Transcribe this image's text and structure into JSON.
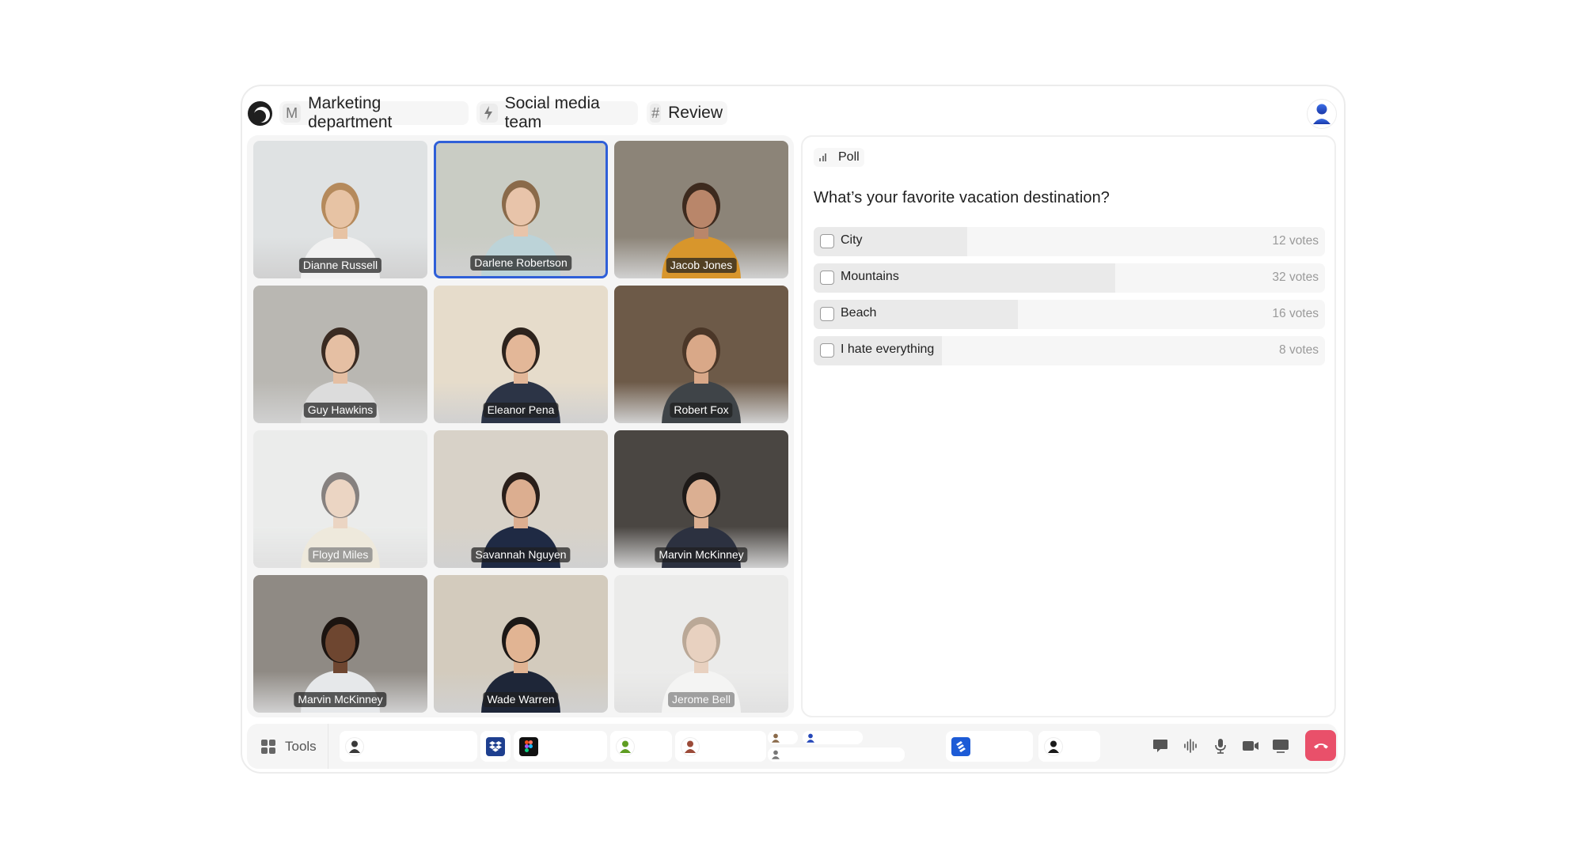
{
  "header": {
    "logo": "app-logo",
    "breadcrumb": [
      {
        "icon_text": "M",
        "icon": "workspace-letter-icon",
        "label": "Marketing department"
      },
      {
        "icon_text": "⚡",
        "icon": "lightning-icon",
        "label": "Social media team"
      },
      {
        "icon_text": "#",
        "icon": "hash-icon",
        "label": "Review"
      }
    ],
    "user_avatar": "user-avatar-icon"
  },
  "participants": [
    {
      "name": "Dianne Russell",
      "active": false,
      "faded": false,
      "bg": "#dfe2e3",
      "skin": "#e7c3a4",
      "hair": "#b58a5c",
      "shirt": "#f1f1f1"
    },
    {
      "name": "Darlene Robertson",
      "active": true,
      "faded": false,
      "bg": "#c9ccc4",
      "skin": "#e8c4aa",
      "hair": "#8a6a4a",
      "shirt": "#bcd3d8"
    },
    {
      "name": "Jacob Jones",
      "active": false,
      "faded": false,
      "bg": "#8c8478",
      "skin": "#b9866a",
      "hair": "#3d2a1e",
      "shirt": "#d8962c"
    },
    {
      "name": "Guy Hawkins",
      "active": false,
      "faded": false,
      "bg": "#b9b7b2",
      "skin": "#e5bfa3",
      "hair": "#3a2b22",
      "shirt": "#dcdcdc"
    },
    {
      "name": "Eleanor Pena",
      "active": false,
      "faded": false,
      "bg": "#e6dccb",
      "skin": "#e3b798",
      "hair": "#2d231d",
      "shirt": "#2c3446"
    },
    {
      "name": "Robert Fox",
      "active": false,
      "faded": false,
      "bg": "#6d5a48",
      "skin": "#d9a888",
      "hair": "#4b3728",
      "shirt": "#3f4448"
    },
    {
      "name": "Floyd Miles",
      "active": false,
      "faded": true,
      "bg": "#e3e6e4",
      "skin": "#e4bb9c",
      "hair": "#2c2420",
      "shirt": "#e9e0c8"
    },
    {
      "name": "Savannah Nguyen",
      "active": false,
      "faded": false,
      "bg": "#d8d2c8",
      "skin": "#dcae90",
      "hair": "#2a1f1a",
      "shirt": "#1f2a44"
    },
    {
      "name": "Marvin McKinney",
      "active": false,
      "faded": false,
      "bg": "#4a4642",
      "skin": "#dbaf92",
      "hair": "#1e1a18",
      "shirt": "#2c3140"
    },
    {
      "name": "Marvin McKinney",
      "active": false,
      "faded": false,
      "bg": "#8f8a84",
      "skin": "#6e4630",
      "hair": "#1c1410",
      "shirt": "#e6e8ea"
    },
    {
      "name": "Wade Warren",
      "active": false,
      "faded": false,
      "bg": "#d3cbbd",
      "skin": "#e1b493",
      "hair": "#1c1816",
      "shirt": "#1e2638"
    },
    {
      "name": "Jerome Bell",
      "active": false,
      "faded": true,
      "bg": "#e4e4e2",
      "skin": "#dfb496",
      "hair": "#8b6b4b",
      "shirt": "#f4f4f2"
    }
  ],
  "poll": {
    "chip_label": "Poll",
    "chip_icon": "poll-bars-icon",
    "question": "What’s your favorite vacation destination?",
    "options": [
      {
        "label": "City",
        "votes_text": "12 votes",
        "votes": 12,
        "fill_fraction": 0.3,
        "checked": false
      },
      {
        "label": "Mountains",
        "votes_text": "32 votes",
        "votes": 32,
        "fill_fraction": 0.59,
        "checked": false
      },
      {
        "label": "Beach",
        "votes_text": "16 votes",
        "votes": 16,
        "fill_fraction": 0.4,
        "checked": false
      },
      {
        "label": "I hate everything",
        "votes_text": "8 votes",
        "votes": 8,
        "fill_fraction": 0.25,
        "checked": false
      }
    ]
  },
  "toolbar": {
    "tools_label": "Tools",
    "tools_icon": "grid-icon",
    "slots": [
      {
        "type": "avatar",
        "icon": "avatar-dark-icon",
        "color": "#3a3a3a"
      },
      {
        "type": "app",
        "icon": "dropbox-icon",
        "color": "#1e3f8f"
      },
      {
        "type": "app",
        "icon": "figma-icon",
        "color": "#111111"
      },
      {
        "type": "avatar",
        "icon": "avatar-green-icon",
        "color": "#5f9d22"
      },
      {
        "type": "avatar",
        "icon": "avatar-brown-icon",
        "color": "#9b4a38"
      },
      {
        "type": "avatar",
        "icon": "avatar-tan-icon",
        "color": "#8a6a4a"
      },
      {
        "type": "avatar",
        "icon": "avatar-blue-icon",
        "color": "#2447b8"
      },
      {
        "type": "avatar",
        "icon": "avatar-gray-icon",
        "color": "#777777"
      },
      {
        "type": "app",
        "icon": "jira-icon",
        "color": "#1d5bd6"
      },
      {
        "type": "avatar",
        "icon": "avatar-black-icon",
        "color": "#1a1a1a"
      }
    ],
    "controls": [
      {
        "icon": "chat-icon"
      },
      {
        "icon": "audio-wave-icon"
      },
      {
        "icon": "microphone-icon"
      },
      {
        "icon": "camera-icon"
      },
      {
        "icon": "screen-share-icon"
      }
    ],
    "end_call_icon": "hang-up-icon",
    "end_call_color": "#e9506a"
  },
  "colors": {
    "active_speaker": "#2f5fd8"
  }
}
